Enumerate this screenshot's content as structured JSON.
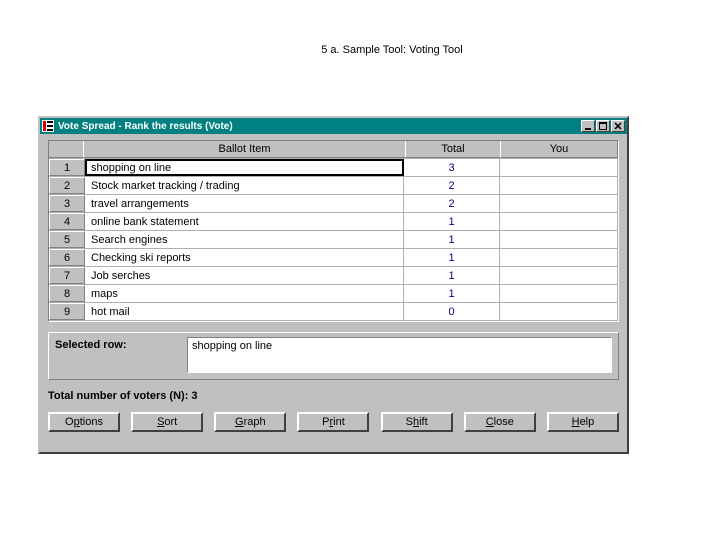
{
  "slide_title": "5 a. Sample Tool: Voting Tool",
  "window": {
    "title": "Vote Spread - Rank the results (Vote)"
  },
  "columns": {
    "ballot": "Ballot Item",
    "total": "Total",
    "you": "You"
  },
  "rows": [
    {
      "n": "1",
      "item": "shopping on line",
      "total": "3",
      "you": ""
    },
    {
      "n": "2",
      "item": "Stock market tracking / trading",
      "total": "2",
      "you": ""
    },
    {
      "n": "3",
      "item": "travel arrangements",
      "total": "2",
      "you": ""
    },
    {
      "n": "4",
      "item": "online bank statement",
      "total": "1",
      "you": ""
    },
    {
      "n": "5",
      "item": "Search engines",
      "total": "1",
      "you": ""
    },
    {
      "n": "6",
      "item": "Checking ski reports",
      "total": "1",
      "you": ""
    },
    {
      "n": "7",
      "item": "Job serches",
      "total": "1",
      "you": ""
    },
    {
      "n": "8",
      "item": "maps",
      "total": "1",
      "you": ""
    },
    {
      "n": "9",
      "item": "hot mail",
      "total": "0",
      "you": ""
    }
  ],
  "selected": {
    "label": "Selected row:",
    "value": "shopping on line"
  },
  "voters_line": "Total number of voters (N):  3",
  "buttons": {
    "options": {
      "pre": "O",
      "u": "p",
      "post": "tions"
    },
    "sort": {
      "pre": "",
      "u": "S",
      "post": "ort"
    },
    "graph": {
      "pre": "",
      "u": "G",
      "post": "raph"
    },
    "print": {
      "pre": "P",
      "u": "r",
      "post": "int"
    },
    "shift": {
      "pre": "S",
      "u": "h",
      "post": "ift"
    },
    "close": {
      "pre": "",
      "u": "C",
      "post": "lose"
    },
    "help": {
      "pre": "",
      "u": "H",
      "post": "elp"
    }
  }
}
